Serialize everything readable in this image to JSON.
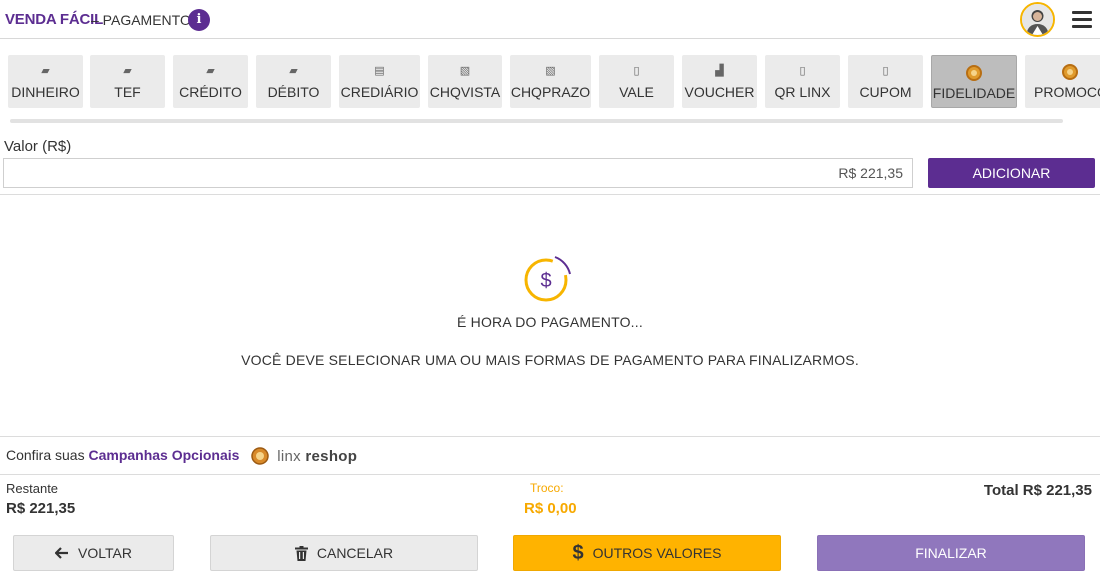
{
  "header": {
    "brand": "VENDA FÁCIL",
    "subtitle": "– PAGAMENTO",
    "info_glyph": "i",
    "icons": [
      "info-icon",
      "user-avatar",
      "hamburger-menu-icon"
    ]
  },
  "payment_methods": [
    {
      "label": "DINHEIRO",
      "icon": "cash-icon",
      "selected": false
    },
    {
      "label": "TEF",
      "icon": "card-icon",
      "selected": false
    },
    {
      "label": "CRÉDITO",
      "icon": "card-icon",
      "selected": false
    },
    {
      "label": "DÉBITO",
      "icon": "card-icon",
      "selected": false
    },
    {
      "label": "CREDIÁRIO",
      "icon": "money-stack-icon",
      "selected": false
    },
    {
      "label": "CHQVISTA",
      "icon": "check-icon",
      "selected": false
    },
    {
      "label": "CHQPRAZO",
      "icon": "check-icon",
      "selected": false
    },
    {
      "label": "VALE",
      "icon": "receipt-icon",
      "selected": false
    },
    {
      "label": "VOUCHER",
      "icon": "voucher-icon",
      "selected": false
    },
    {
      "label": "QR LINX",
      "icon": "qr-phone-icon",
      "selected": false
    },
    {
      "label": "CUPOM",
      "icon": "coupon-icon",
      "selected": false
    },
    {
      "label": "FIDELIDADE",
      "icon": "loyalty-coin-icon",
      "selected": true
    },
    {
      "label": "PROMOCOES",
      "icon": "loyalty-coin-icon",
      "selected": false
    }
  ],
  "valor": {
    "label": "Valor (R$)",
    "value": "R$ 221,35",
    "add_label": "ADICIONAR"
  },
  "message": {
    "title": "É HORA DO PAGAMENTO...",
    "body": "VOCÊ DEVE SELECIONAR UMA OU MAIS FORMAS DE PAGAMENTO PARA FINALIZARMOS.",
    "icon_glyph": "$"
  },
  "campanhas": {
    "prefix": "Confira suas",
    "link": "Campanhas Opcionais",
    "logo_light": "linx",
    "logo_bold": "reshop"
  },
  "totals": {
    "restante_label": "Restante",
    "restante_value": "R$ 221,35",
    "troco_label": "Troco:",
    "troco_value": "R$ 0,00",
    "total": "Total R$ 221,35"
  },
  "buttons": {
    "voltar": "VOLTAR",
    "cancelar": "CANCELAR",
    "outros": "OUTROS VALORES",
    "finalizar": "FINALIZAR",
    "outros_glyph": "$"
  },
  "colors": {
    "brand": "#5c2d91",
    "accent": "#ffb300",
    "finalizar": "#9077bd"
  }
}
